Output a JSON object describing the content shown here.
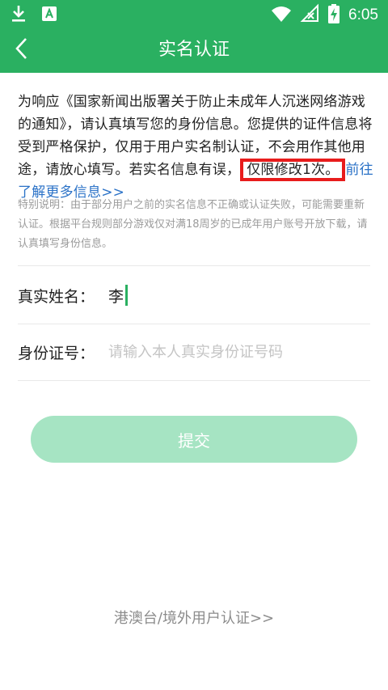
{
  "statusbar": {
    "time": "6:05",
    "icons": [
      "download-icon",
      "app-badge-icon",
      "wifi-icon",
      "signal-off-icon",
      "battery-charging-icon"
    ]
  },
  "appbar": {
    "title": "实名认证",
    "back_icon": "chevron-left-icon"
  },
  "notice": {
    "text": "为响应《国家新闻出版署关于防止未成年人沉迷网络游戏的通知》，请认真填写您的身份信息。您提供的证件信息将受到严格保护，仅用于用户实名制认证，不会用作其他用途，请放心填写。若实名信息有误，",
    "highlight": "仅限修改1次。",
    "more_link": "前往了解更多信息>>"
  },
  "special_note": "特别说明：由于部分用户之前的实名信息不正确或认证失败，可能需要重新认证。根据平台规则部分游戏仅对满18周岁的已成年用户账号开放下载，请认真填写身份信息。",
  "form": {
    "name_label": "真实姓名：",
    "name_value": "李",
    "id_label": "身份证号：",
    "id_placeholder": "请输入本人真实身份证号码",
    "id_value": ""
  },
  "submit_label": "提交",
  "foreign_link": "港澳台/境外用户认证>>",
  "colors": {
    "brand_green": "#2ab061",
    "submit_disabled": "#a6e4c3",
    "link_blue": "#2b72c7",
    "highlight_red": "#e81c1c"
  }
}
